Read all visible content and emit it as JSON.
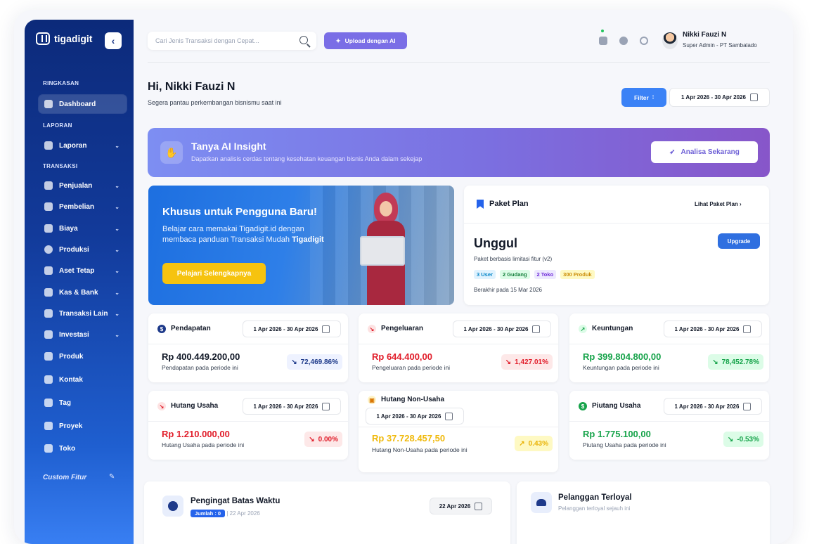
{
  "app": {
    "name": "tigadigit"
  },
  "sidebar": {
    "sections": [
      "RINGKASAN",
      "LAPORAN",
      "TRANSAKSI"
    ],
    "items": [
      {
        "label": "Dashboard"
      },
      {
        "label": "Laporan"
      },
      {
        "label": "Penjualan"
      },
      {
        "label": "Pembelian"
      },
      {
        "label": "Biaya"
      },
      {
        "label": "Produksi"
      },
      {
        "label": "Aset Tetap"
      },
      {
        "label": "Kas & Bank"
      },
      {
        "label": "Transaksi Lain"
      },
      {
        "label": "Investasi"
      },
      {
        "label": "Produk"
      },
      {
        "label": "Kontak"
      },
      {
        "label": "Tag"
      },
      {
        "label": "Proyek"
      },
      {
        "label": "Toko"
      }
    ],
    "custom": "Custom Fitur"
  },
  "topbar": {
    "search_placeholder": "Cari Jenis Transaksi dengan Cepat...",
    "upload_label": "Upload dengan AI",
    "user_name": "Nikki Fauzi N",
    "user_role": "Super Admin - PT Sambalado"
  },
  "greeting": {
    "title": "Hi, Nikki Fauzi N",
    "subtitle": "Segera pantau perkembangan bisnismu saat ini",
    "filter_label": "Filter",
    "date_range": "1 Apr 2026 - 30 Apr 2026"
  },
  "ai": {
    "title": "Tanya AI Insight",
    "subtitle": "Dapatkan analisis cerdas tentang kesehatan keuangan bisnis Anda dalam sekejap",
    "button": "Analisa Sekarang"
  },
  "promo": {
    "title": "Khusus untuk Pengguna Baru!",
    "text": "Belajar cara memakai Tigadigit.id dengan membaca panduan Transaksi Mudah",
    "brand": "Tigadigit",
    "button": "Pelajari Selengkapnya"
  },
  "plan": {
    "title": "Paket Plan",
    "link": "Lihat Paket Plan",
    "name": "Unggul",
    "desc": "Paket berbasis limitasi fitur (v2)",
    "upgrade": "Upgrade",
    "tags": [
      "3 User",
      "2 Gudang",
      "2 Toko",
      "300 Produk"
    ],
    "expiry": "Berakhir pada 15 Mar 2026"
  },
  "cards": [
    {
      "title": "Pendapatan",
      "date": "1 Apr 2026 - 30 Apr 2026",
      "value": "Rp 400.449.200,00",
      "sub": "Pendapatan pada periode ini",
      "pct": "72,469.86%"
    },
    {
      "title": "Pengeluaran",
      "date": "1 Apr 2026 - 30 Apr 2026",
      "value": "Rp 644.400,00",
      "sub": "Pengeluaran pada periode ini",
      "pct": "1,427.01%"
    },
    {
      "title": "Keuntungan",
      "date": "1 Apr 2026 - 30 Apr 2026",
      "value": "Rp 399.804.800,00",
      "sub": "Keuntungan pada periode ini",
      "pct": "78,452.78%"
    },
    {
      "title": "Hutang Usaha",
      "date": "1 Apr 2026 - 30 Apr 2026",
      "value": "Rp 1.210.000,00",
      "sub": "Hutang Usaha pada periode ini",
      "pct": "0.00%"
    },
    {
      "title": "Hutang Non-Usaha",
      "date": "1 Apr 2026 - 30 Apr 2026",
      "value": "Rp 37.728.457,50",
      "sub": "Hutang Non-Usaha pada periode ini",
      "pct": "0.43%"
    },
    {
      "title": "Piutang Usaha",
      "date": "1 Apr 2026 - 30 Apr 2026",
      "value": "Rp 1.775.100,00",
      "sub": "Piutang Usaha pada periode ini",
      "pct": "-0.53%"
    }
  ],
  "reminder": {
    "title": "Pengingat Batas Waktu",
    "count": "Jumlah : 0",
    "date": "22 Apr 2026",
    "date_chip": "22 Apr 2026"
  },
  "loyal": {
    "title": "Pelanggan Terloyal",
    "subtitle": "Pelanggan terloyal sejauh ini"
  },
  "colors": {
    "primary": "#2563eb",
    "ai_gradient_start": "#7d8ef2",
    "ai_gradient_end": "#8756c9",
    "negative": "#e11d2a",
    "positive": "#16a34a",
    "warning": "#f0b90b",
    "promo_button": "#f6c30f"
  }
}
